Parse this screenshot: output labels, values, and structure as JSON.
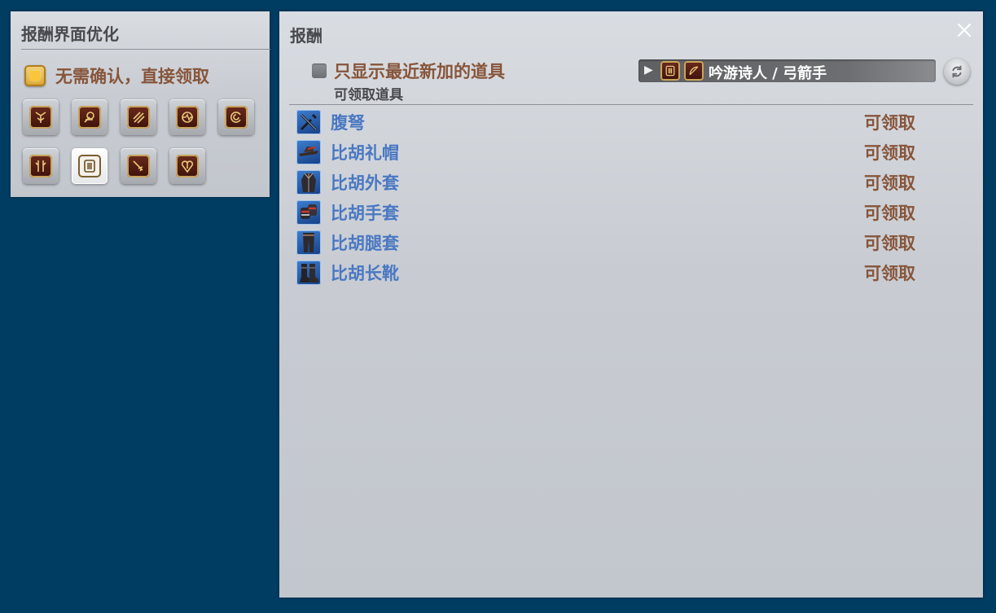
{
  "options_panel": {
    "title": "报酬界面优化",
    "auto_claim_label": "无需确认，直接领取",
    "auto_claim_checked": true,
    "job_buttons": [
      {
        "icon": "paladin-job-icon",
        "selected": false
      },
      {
        "icon": "monk-job-icon",
        "selected": false
      },
      {
        "icon": "warrior-job-icon",
        "selected": false
      },
      {
        "icon": "dragoon-job-icon",
        "selected": false
      },
      {
        "icon": "white-mage-job-icon",
        "selected": false
      },
      {
        "icon": "black-mage-job-icon",
        "selected": false
      },
      {
        "icon": "bard-job-icon",
        "selected": true
      },
      {
        "icon": "summoner-job-icon",
        "selected": false
      },
      {
        "icon": "scholar-job-icon",
        "selected": false
      }
    ]
  },
  "reward_panel": {
    "title": "报酬",
    "recent_only_label": "只显示最近新加的道具",
    "recent_only_checked": false,
    "subtitle": "可领取道具",
    "job_dropdown_label": "吟游诗人 / 弓箭手",
    "items": [
      {
        "name": "腹弩",
        "status": "可领取",
        "icon": "crossbow-icon"
      },
      {
        "name": "比胡礼帽",
        "status": "可领取",
        "icon": "hat-icon"
      },
      {
        "name": "比胡外套",
        "status": "可领取",
        "icon": "coat-icon"
      },
      {
        "name": "比胡手套",
        "status": "可领取",
        "icon": "gloves-icon"
      },
      {
        "name": "比胡腿套",
        "status": "可领取",
        "icon": "leggings-icon"
      },
      {
        "name": "比胡长靴",
        "status": "可领取",
        "icon": "boots-icon"
      }
    ]
  },
  "colors": {
    "background": "#003d63",
    "panel": "#c8ccd2",
    "item_name": "#4a78c2",
    "status": "#87553a",
    "checkbox_gold": "#f9c53a"
  }
}
